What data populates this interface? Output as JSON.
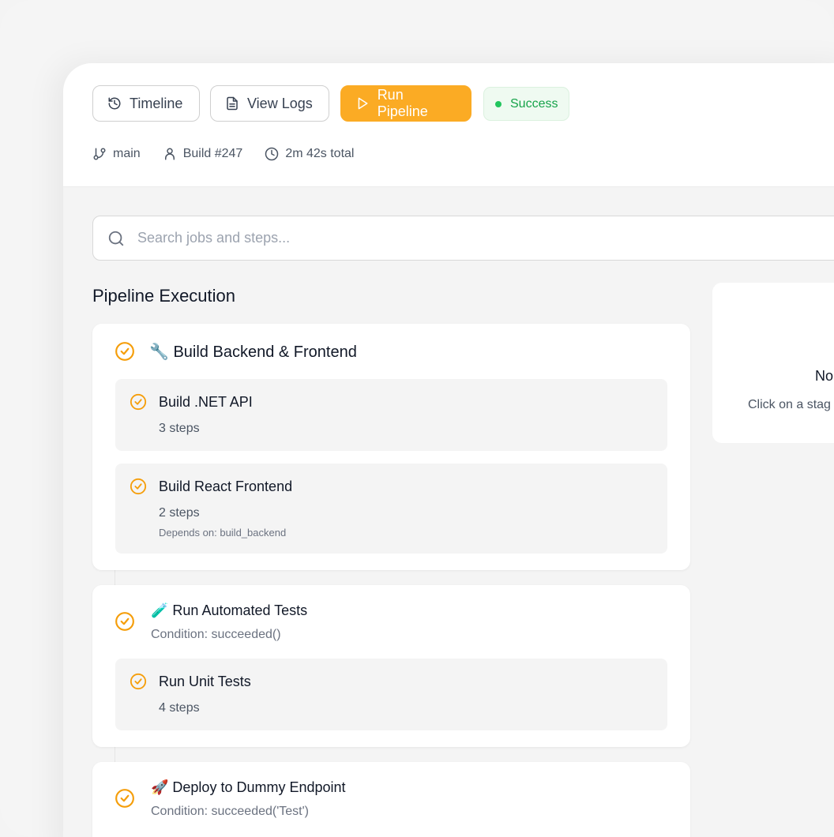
{
  "toolbar": {
    "timeline_label": "Timeline",
    "view_logs_label": "View Logs",
    "run_pipeline_label": "Run Pipeline",
    "status_label": "Success"
  },
  "meta": {
    "branch": "main",
    "build": "Build #247",
    "duration": "2m 42s total"
  },
  "search": {
    "placeholder": "Search jobs and steps..."
  },
  "section_title": "Pipeline Execution",
  "stages": [
    {
      "title": "🔧 Build Backend & Frontend",
      "condition": "",
      "jobs": [
        {
          "title": "Build .NET API",
          "steps": "3 steps",
          "depends": ""
        },
        {
          "title": "Build React Frontend",
          "steps": "2 steps",
          "depends": "Depends on: build_backend"
        }
      ]
    },
    {
      "title": "🧪 Run Automated Tests",
      "condition": "Condition: succeeded()",
      "jobs": [
        {
          "title": "Run Unit Tests",
          "steps": "4 steps",
          "depends": ""
        }
      ]
    },
    {
      "title": "🚀 Deploy to Dummy Endpoint",
      "condition": "Condition: succeeded('Test')",
      "jobs": []
    }
  ],
  "details_panel": {
    "title": "No",
    "subtitle": "Click on a stag"
  },
  "colors": {
    "accent": "#fbab24",
    "success": "#16a34a",
    "success_bg": "#effaf1"
  },
  "icons": [
    "history-icon",
    "file-text-icon",
    "play-icon",
    "git-branch-icon",
    "user-icon",
    "clock-icon",
    "search-icon",
    "check-circle-icon"
  ]
}
